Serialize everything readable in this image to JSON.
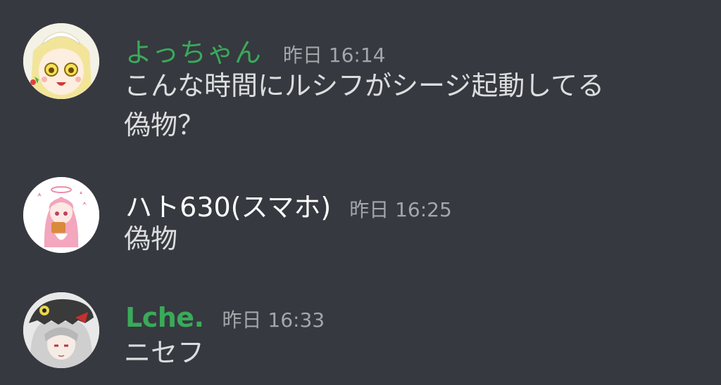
{
  "colors": {
    "background": "#36393f",
    "username_green": "#43b581",
    "username_white": "#ffffff",
    "timestamp": "#a3a6aa",
    "text": "#dcddde"
  },
  "messages": [
    {
      "username": "よっちゃん",
      "username_color": "#3aaa5a",
      "timestamp": "昨日 16:14",
      "avatar_icon": "anime-girl-blonde-avatar",
      "lines": [
        "こんな時間にルシフがシージ起動してる",
        "偽物？"
      ]
    },
    {
      "username": "ハト630(スマホ)",
      "username_color": "#ffffff",
      "timestamp": "昨日 16:25",
      "avatar_icon": "anime-girl-pink-hair-avatar",
      "lines": [
        "偽物"
      ]
    },
    {
      "username": "Lche.",
      "username_color": "#3aaa5a",
      "timestamp": "昨日 16:33",
      "avatar_icon": "anime-girl-dino-hood-avatar",
      "lines": [
        "ニセフ"
      ]
    }
  ]
}
